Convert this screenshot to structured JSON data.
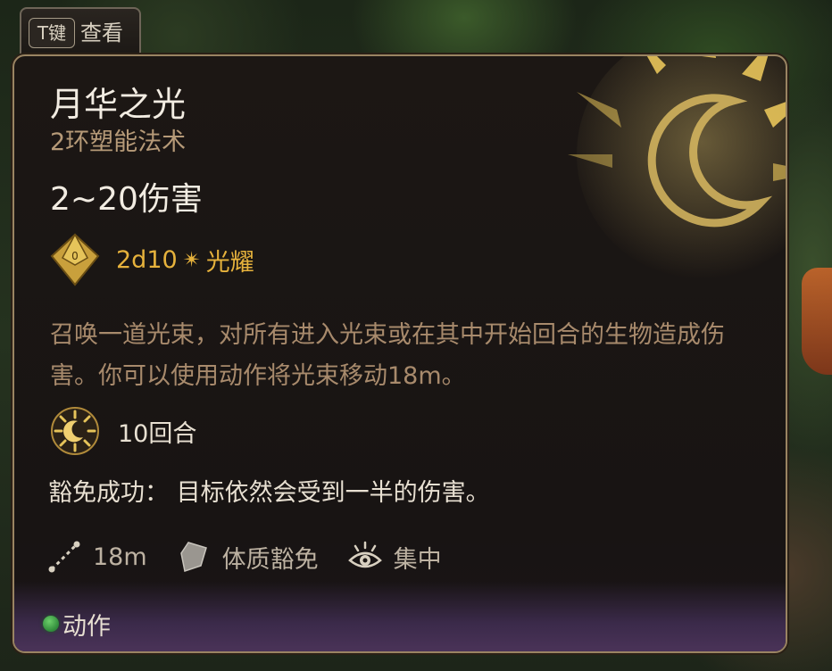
{
  "hint": {
    "key": "T键",
    "label": "查看"
  },
  "spell": {
    "name": "月华之光",
    "level_school": "2环塑能法术",
    "damage_range": "2~20伤害",
    "dice": "2d10",
    "damage_type": "光耀",
    "description": "召唤一道光束，对所有进入光束或在其中开始回合的生物造成伤害。你可以使用动作将光束移动18m。",
    "duration": "10回合",
    "save_success": "豁免成功：  目标依然会受到一半的伤害。",
    "range": "18m",
    "saving_throw": "体质豁免",
    "concentration": "集中",
    "action_type": "动作"
  },
  "icons": {
    "dice": "d10-dice-icon",
    "radiant": "radiant-sparkle-icon",
    "duration": "moon-sun-duration-icon",
    "range": "range-line-icon",
    "save": "shield-save-icon",
    "concentration": "eye-concentration-icon",
    "action": "green-action-dot-icon"
  },
  "colors": {
    "gold": "#e6b23c",
    "subtitle": "#b69a78",
    "description": "#a88a6c",
    "text": "#e8e0d2",
    "border": "#9a8462",
    "footer_purple": "#4a3358",
    "action_green": "#3fa84a"
  }
}
